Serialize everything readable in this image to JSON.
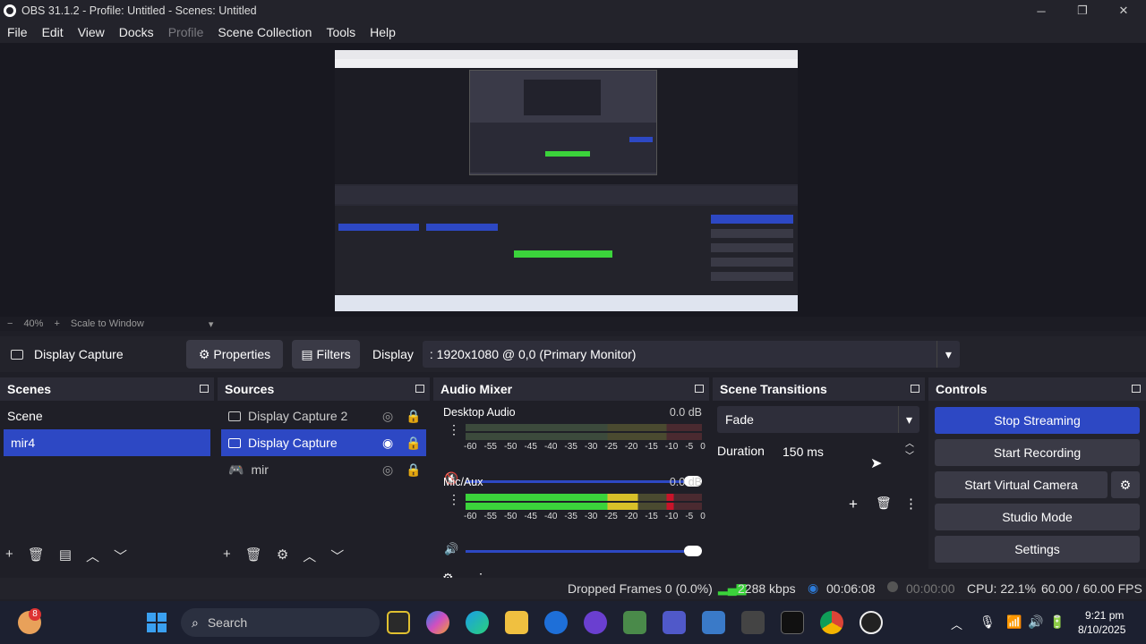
{
  "window": {
    "title": "OBS 31.1.2 - Profile: Untitled - Scenes: Untitled"
  },
  "menu": [
    "File",
    "Edit",
    "View",
    "Docks",
    "Profile",
    "Scene Collection",
    "Tools",
    "Help"
  ],
  "zoom": {
    "minus": "−",
    "level": "40%",
    "plus": "+",
    "mode": "Scale to Window"
  },
  "source_bar": {
    "name": "Display Capture",
    "properties": "Properties",
    "filters": "Filters",
    "display_label": "Display",
    "display_value": ": 1920x1080 @ 0,0 (Primary Monitor)"
  },
  "scenes": {
    "title": "Scenes",
    "items": [
      "Scene",
      "mir4"
    ],
    "selected": 1
  },
  "sources": {
    "title": "Sources",
    "items": [
      "Display Capture 2",
      "Display Capture",
      "mir"
    ],
    "selected": 1
  },
  "mixer": {
    "title": "Audio Mixer",
    "channels": [
      {
        "name": "Desktop Audio",
        "db": "0.0 dB",
        "level": 0
      },
      {
        "name": "Mic/Aux",
        "db": "0.0 dB",
        "level": 0.85
      }
    ],
    "ticks": [
      "-60",
      "-55",
      "-50",
      "-45",
      "-40",
      "-35",
      "-30",
      "-25",
      "-20",
      "-15",
      "-10",
      "-5",
      "0"
    ]
  },
  "transitions": {
    "title": "Scene Transitions",
    "selected": "Fade",
    "duration_label": "Duration",
    "duration_value": "150 ms"
  },
  "controls": {
    "title": "Controls",
    "stop_streaming": "Stop Streaming",
    "start_recording": "Start Recording",
    "start_virtual_camera": "Start Virtual Camera",
    "studio_mode": "Studio Mode",
    "settings": "Settings"
  },
  "status": {
    "dropped": "Dropped Frames 0 (0.0%)",
    "bitrate": "2288 kbps",
    "stream_time": "00:06:08",
    "rec_time": "00:00:00",
    "cpu": "CPU: 22.1%",
    "fps": "60.00 / 60.00 FPS"
  },
  "taskbar": {
    "search": "Search",
    "badge": "8",
    "time": "9:21 pm",
    "date": "8/10/2025"
  },
  "colors": {
    "accent": "#2d48c4",
    "meter_green": "#3bd33b",
    "meter_yellow": "#d8c029",
    "meter_red": "#c8142a",
    "bg": "#1f1f27"
  }
}
